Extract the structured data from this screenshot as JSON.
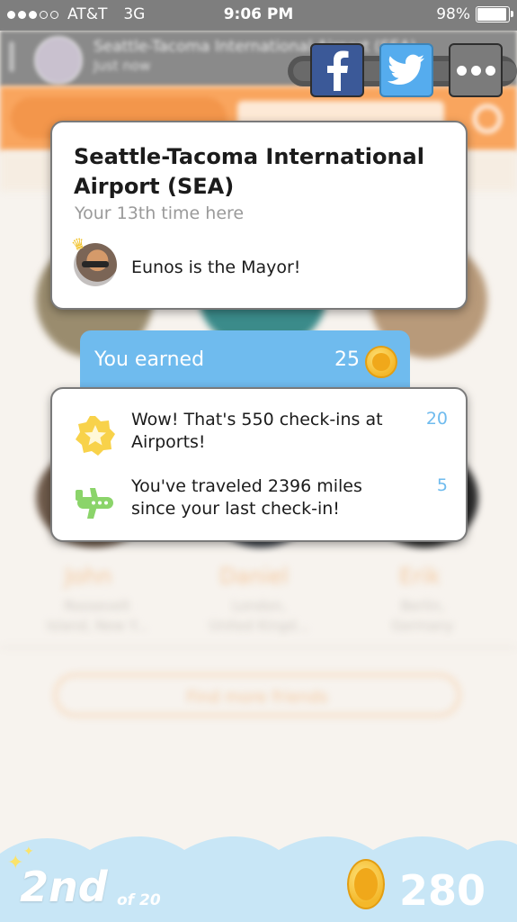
{
  "status_bar": {
    "carrier": "AT&T",
    "network": "3G",
    "time": "9:06 PM",
    "battery": "98%"
  },
  "background_app": {
    "header_title": "Seattle-Tacoma International Airport (SEA)",
    "header_subtitle": "Just now",
    "find_more_friends": "Find more friends",
    "friends": [
      {
        "name": "John",
        "location_line1": "Roosevelt",
        "location_line2": "Island, New Y..."
      },
      {
        "name": "Daniel",
        "location_line1": "London,",
        "location_line2": "United Kingd..."
      },
      {
        "name": "Erik",
        "location_line1": "Berlin,",
        "location_line2": "Germany"
      }
    ]
  },
  "share": {
    "facebook_icon": "facebook-icon",
    "twitter_icon": "twitter-icon",
    "more_icon": "more-icon"
  },
  "venue_card": {
    "title": "Seattle-Tacoma International Airport (SEA)",
    "visits": "Your 13th time here",
    "mayor_text": "Eunos is the Mayor!"
  },
  "earned": {
    "label": "You earned",
    "total": "25"
  },
  "rewards": [
    {
      "text": "Wow! That's 550 check-ins at Airports!",
      "points": "20",
      "icon": "star-badge-icon"
    },
    {
      "text": "You've traveled 2396 miles since your last check-in!",
      "points": "5",
      "icon": "airplane-icon"
    }
  ],
  "leaderboard": {
    "rank": "2nd",
    "of": "of 20",
    "coins": "280"
  },
  "colors": {
    "accent_orange": "#f9a55e",
    "accent_blue": "#6fbbee",
    "coin_gold": "#f4b82a",
    "facebook": "#3b5998",
    "twitter": "#55acee"
  }
}
